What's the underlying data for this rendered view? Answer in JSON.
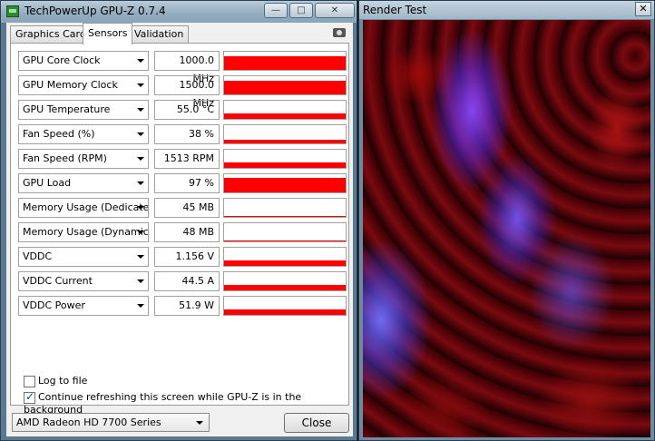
{
  "gpuz": {
    "title": "TechPowerUp GPU-Z 0.7.4",
    "window_buttons": {
      "minimize": "—",
      "maximize": "□",
      "close": "✕"
    },
    "tabs": [
      {
        "label": "Graphics Card",
        "active": false
      },
      {
        "label": "Sensors",
        "active": true
      },
      {
        "label": "Validation",
        "active": false
      }
    ],
    "sensors": [
      {
        "name": "GPU Core Clock",
        "value": "1000.0 MHz",
        "graph_level": 0.75
      },
      {
        "name": "GPU Memory Clock",
        "value": "1500.0 MHz",
        "graph_level": 0.75
      },
      {
        "name": "GPU Temperature",
        "value": "55.0 °C",
        "graph_level": 0.3
      },
      {
        "name": "Fan Speed (%)",
        "value": "38 %",
        "graph_level": 0.2
      },
      {
        "name": "Fan Speed (RPM)",
        "value": "1513 RPM",
        "graph_level": 0.3
      },
      {
        "name": "GPU Load",
        "value": "97 %",
        "graph_level": 0.8
      },
      {
        "name": "Memory Usage (Dedicated)",
        "value": "45 MB",
        "graph_level": 0.04
      },
      {
        "name": "Memory Usage (Dynamic)",
        "value": "48 MB",
        "graph_level": 0.04
      },
      {
        "name": "VDDC",
        "value": "1.156 V",
        "graph_level": 0.32
      },
      {
        "name": "VDDC Current",
        "value": "44.5 A",
        "graph_level": 0.32
      },
      {
        "name": "VDDC Power",
        "value": "51.9 W",
        "graph_level": 0.32
      }
    ],
    "log_to_file": {
      "label": "Log to file",
      "checked": false
    },
    "continue_refresh": {
      "label": "Continue refreshing this screen while GPU-Z is in the background",
      "checked": true
    },
    "gpu_select": {
      "value": "AMD Radeon HD 7700 Series"
    },
    "close_label": "Close"
  },
  "render_test": {
    "title": "Render Test",
    "close": "✕"
  },
  "colors": {
    "graph_fill": "#ff0000",
    "titlebar": "#93acbf"
  }
}
